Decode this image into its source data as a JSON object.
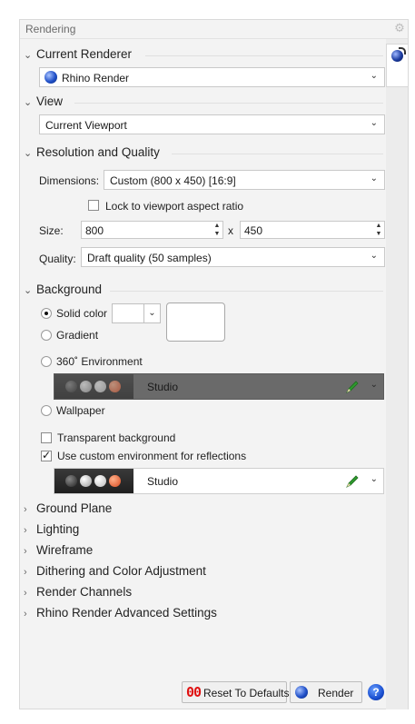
{
  "panel": {
    "title": "Rendering",
    "gear_icon": "gear-icon",
    "side_tab_icon": "rhino-render-icon"
  },
  "current_renderer": {
    "header": "Current Renderer",
    "value": "Rhino Render"
  },
  "view": {
    "header": "View",
    "value": "Current Viewport"
  },
  "resolution": {
    "header": "Resolution and Quality",
    "dimensions_label": "Dimensions:",
    "dimensions_value": "Custom (800 x 450) [16:9]",
    "lock_label": "Lock to viewport aspect ratio",
    "lock_checked": false,
    "size_label": "Size:",
    "width": "800",
    "times": "x",
    "height": "450",
    "quality_label": "Quality:",
    "quality_value": "Draft quality (50 samples)"
  },
  "background": {
    "header": "Background",
    "solid_color_label": "Solid color",
    "gradient_label": "Gradient",
    "env360_label": "360˚ Environment",
    "env360_value": "Studio",
    "wallpaper_label": "Wallpaper",
    "selected": "Solid color",
    "swatch_color": "#ffffff",
    "transparent_label": "Transparent background",
    "transparent_checked": false,
    "custom_env_label": "Use custom environment for reflections",
    "custom_env_checked": true,
    "custom_env_value": "Studio"
  },
  "collapsed_sections": [
    "Ground Plane",
    "Lighting",
    "Wireframe",
    "Dithering and Color Adjustment",
    "Render Channels",
    "Rhino Render Advanced Settings"
  ],
  "footer": {
    "reset_icon_text": "00",
    "reset_label": "Reset To Defaults",
    "render_label": "Render",
    "help_label": "?"
  },
  "colors": {
    "accent_red": "#e01010",
    "pencil_green": "#2e9a2e",
    "globe_blue": "#2050c8"
  }
}
